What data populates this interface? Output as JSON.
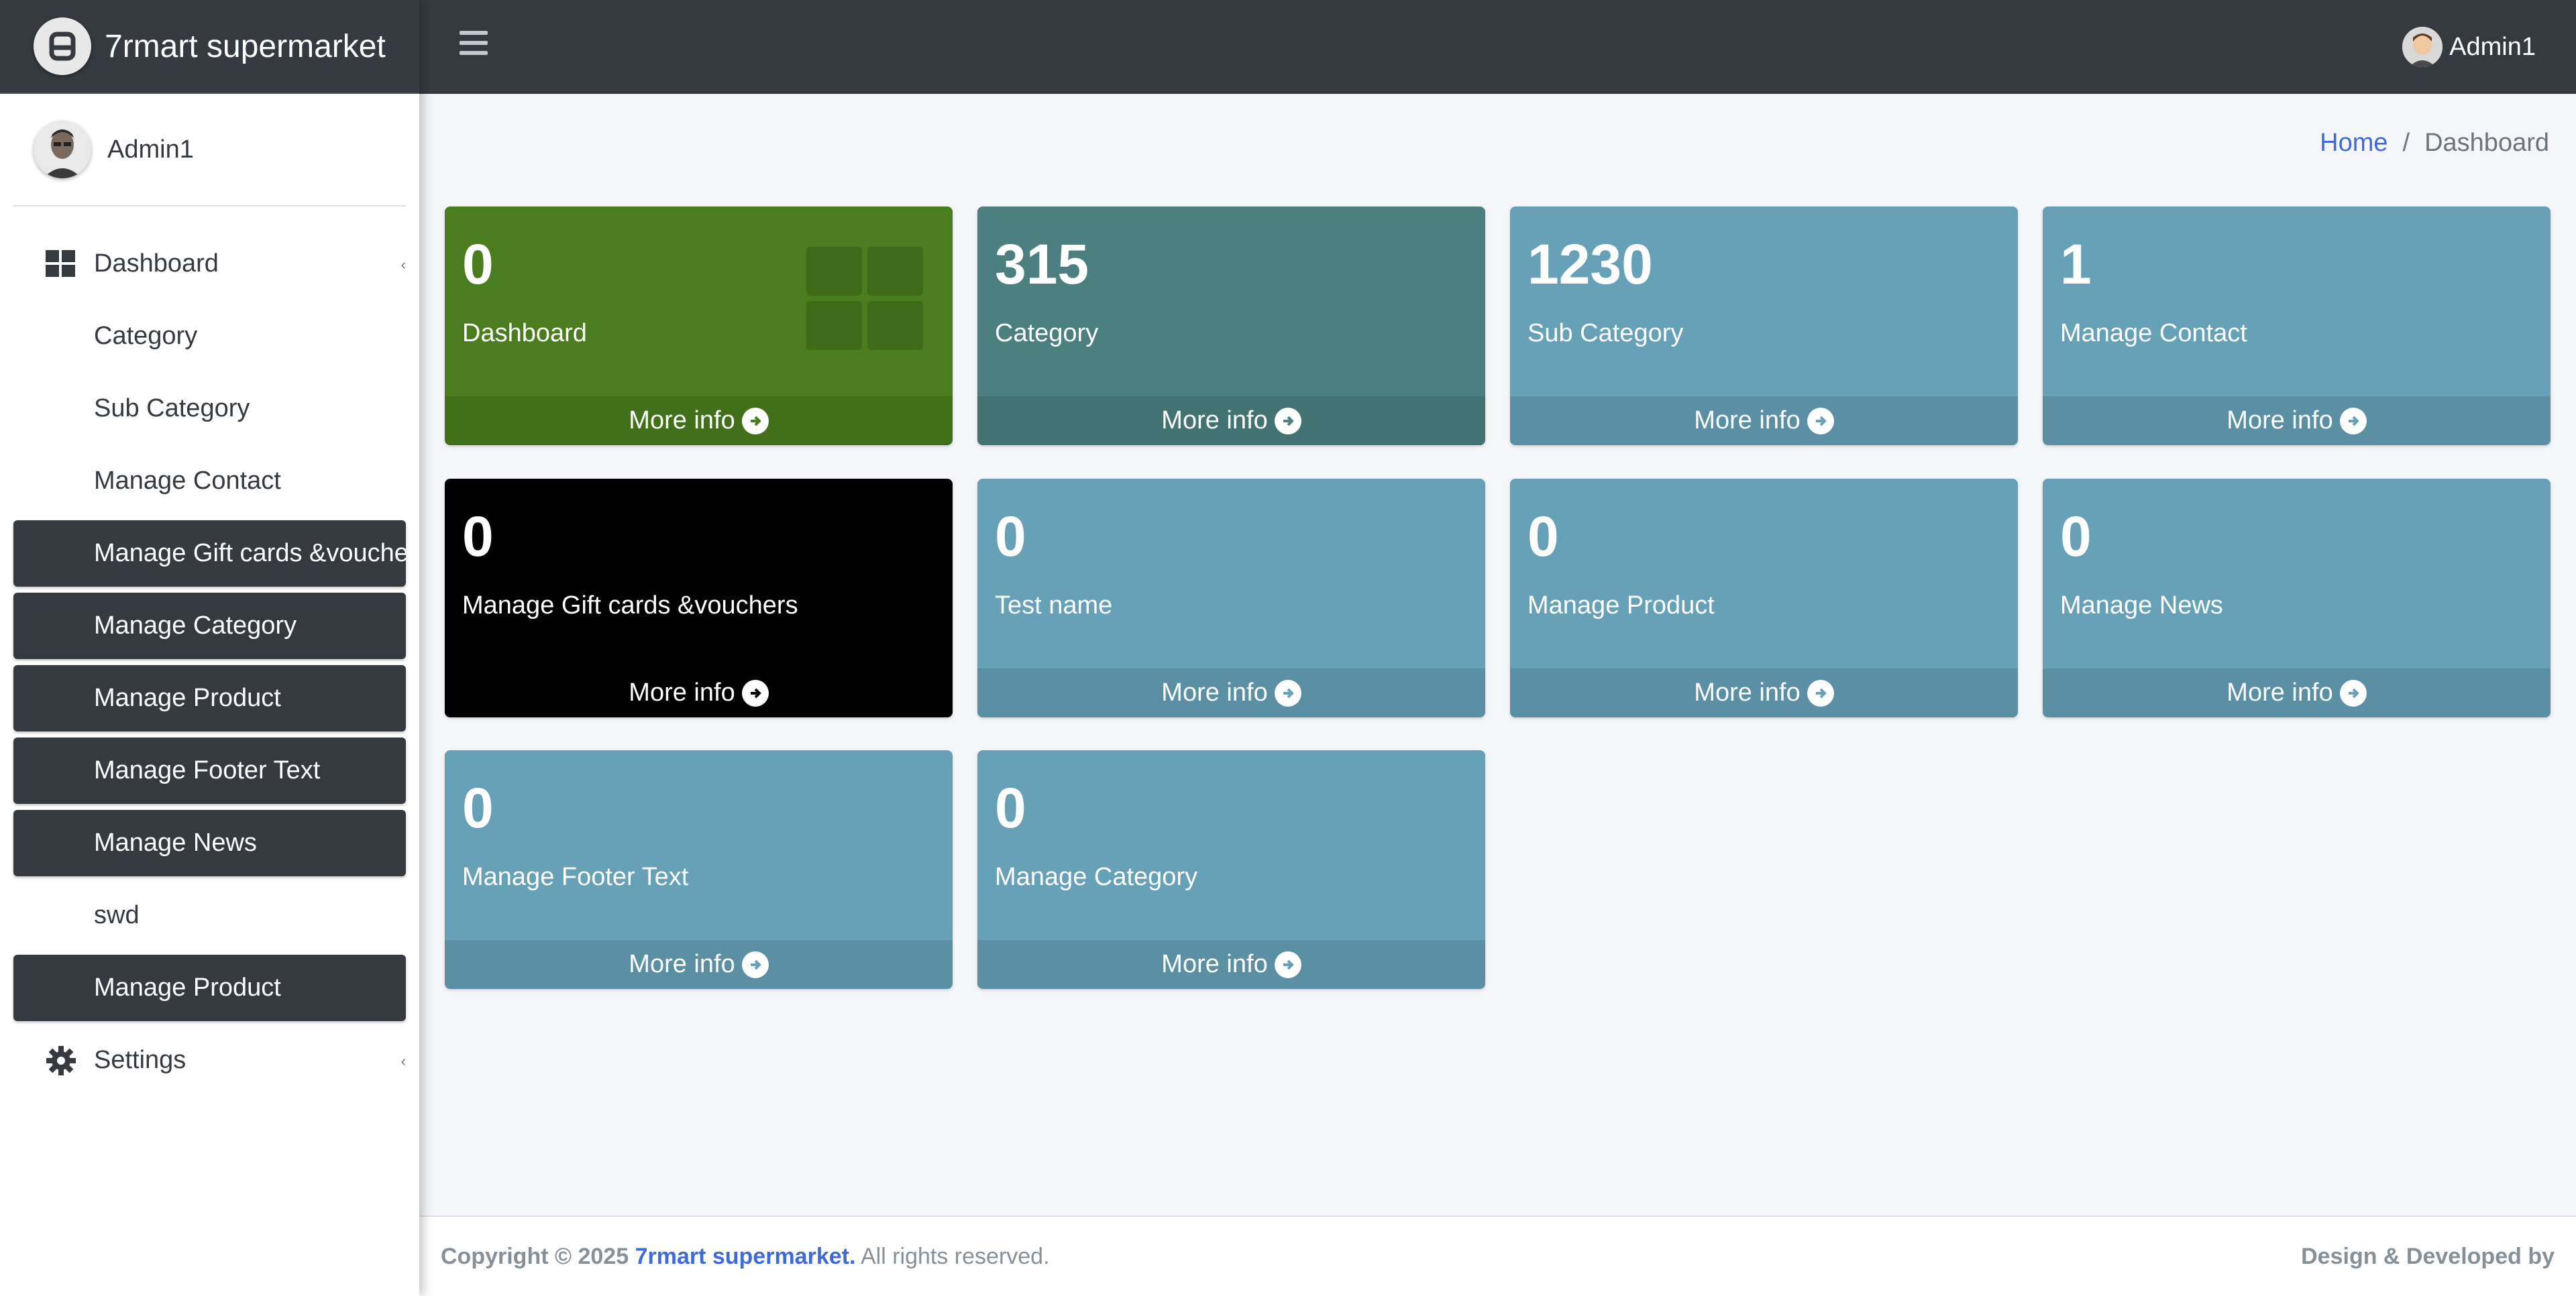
{
  "brand": {
    "name": "7rmart supermarket"
  },
  "sidebar": {
    "user_name": "Admin1",
    "items": [
      {
        "label": "Dashboard",
        "icon": "dashboard-grid-icon",
        "style": "plain"
      },
      {
        "label": "Category",
        "style": "sub"
      },
      {
        "label": "Sub Category",
        "style": "sub"
      },
      {
        "label": "Manage Contact",
        "style": "sub"
      },
      {
        "label": "Manage Gift cards &vouchers",
        "style": "dark"
      },
      {
        "label": "Manage Category",
        "style": "dark"
      },
      {
        "label": "Manage Product",
        "style": "dark"
      },
      {
        "label": "Manage Footer Text",
        "style": "dark"
      },
      {
        "label": "Manage News",
        "style": "dark"
      },
      {
        "label": "swd",
        "style": "sub"
      },
      {
        "label": "Manage Product",
        "style": "dark"
      },
      {
        "label": "Settings",
        "icon": "gear-icon",
        "style": "plain"
      }
    ]
  },
  "topbar": {
    "user_name": "Admin1"
  },
  "breadcrumb": {
    "home": "Home",
    "separator": "/",
    "current": "Dashboard"
  },
  "cards": [
    {
      "value": "0",
      "label": "Dashboard",
      "more": "More info",
      "color": "#4a7d1e"
    },
    {
      "value": "315",
      "label": "Category",
      "more": "More info",
      "color": "#4b7f80"
    },
    {
      "value": "1230",
      "label": "Sub Category",
      "more": "More info",
      "color": "#66a1b7"
    },
    {
      "value": "1",
      "label": "Manage Contact",
      "more": "More info",
      "color": "#66a1b7"
    },
    {
      "value": "0",
      "label": "Manage Gift cards &vouchers",
      "more": "More info",
      "color": "#000000"
    },
    {
      "value": "0",
      "label": "Test name",
      "more": "More info",
      "color": "#66a1b7"
    },
    {
      "value": "0",
      "label": "Manage Product",
      "more": "More info",
      "color": "#66a1b7"
    },
    {
      "value": "0",
      "label": "Manage News",
      "more": "More info",
      "color": "#66a1b7"
    },
    {
      "value": "0",
      "label": "Manage Footer Text",
      "more": "More info",
      "color": "#66a1b7"
    },
    {
      "value": "0",
      "label": "Manage Category",
      "more": "More info",
      "color": "#66a1b7"
    }
  ],
  "footer": {
    "copyright": "Copyright © 2025",
    "company": "7rmart supermarket.",
    "rights": "All rights reserved.",
    "credit": "Design & Developed by"
  }
}
